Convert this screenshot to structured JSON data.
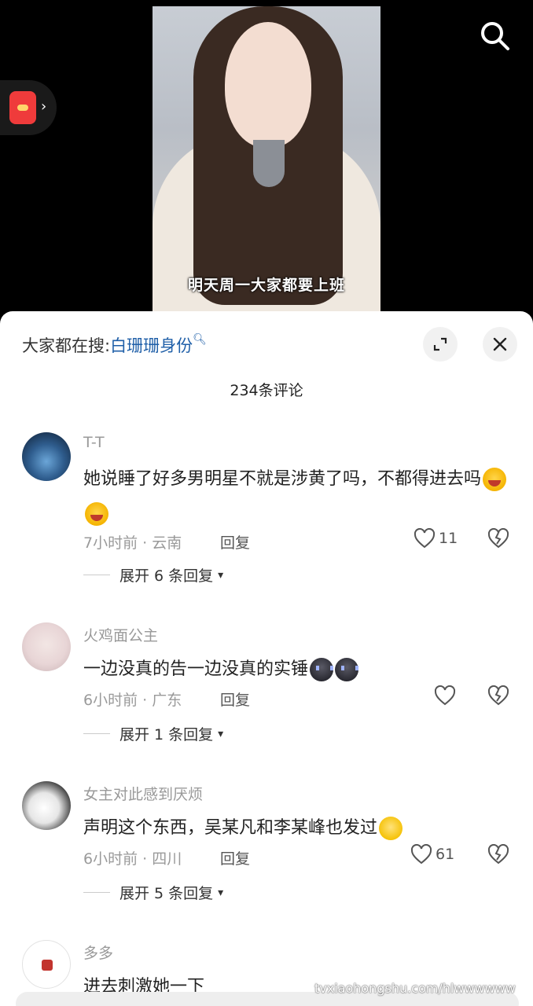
{
  "video": {
    "caption": "明天周一大家都要上班"
  },
  "comments_panel": {
    "search_prefix": "大家都在搜:",
    "search_term": "白珊珊身份",
    "count_label": "234条评论",
    "reply_label": "回复"
  },
  "comments": [
    {
      "username": "T-T",
      "text": "她说睡了好多男明星不就是涉黄了吗，不都得进去吗",
      "time_location": "7小时前 · 云南",
      "likes": "11",
      "expand_label": "展开 6 条回复"
    },
    {
      "username": "火鸡面公主",
      "text": "一边没真的告一边没真的实锤",
      "time_location": "6小时前 · 广东",
      "likes": "",
      "expand_label": "展开 1 条回复"
    },
    {
      "username": "女主对此感到厌烦",
      "text": "声明这个东西，吴某凡和李某峰也发过",
      "time_location": "6小时前 · 四川",
      "likes": "61",
      "expand_label": "展开 5 条回复"
    },
    {
      "username": "多多",
      "text": "进去刺激她一下",
      "time_location": "",
      "likes": "",
      "expand_label": ""
    }
  ],
  "watermark": "tvxiaohongshu.com/hlwwwwww",
  "icons": [
    "search-icon",
    "red-packet-icon",
    "chevron-right-icon",
    "expand-icon",
    "close-icon",
    "heart-icon",
    "broken-heart-icon",
    "chevron-down-icon"
  ]
}
